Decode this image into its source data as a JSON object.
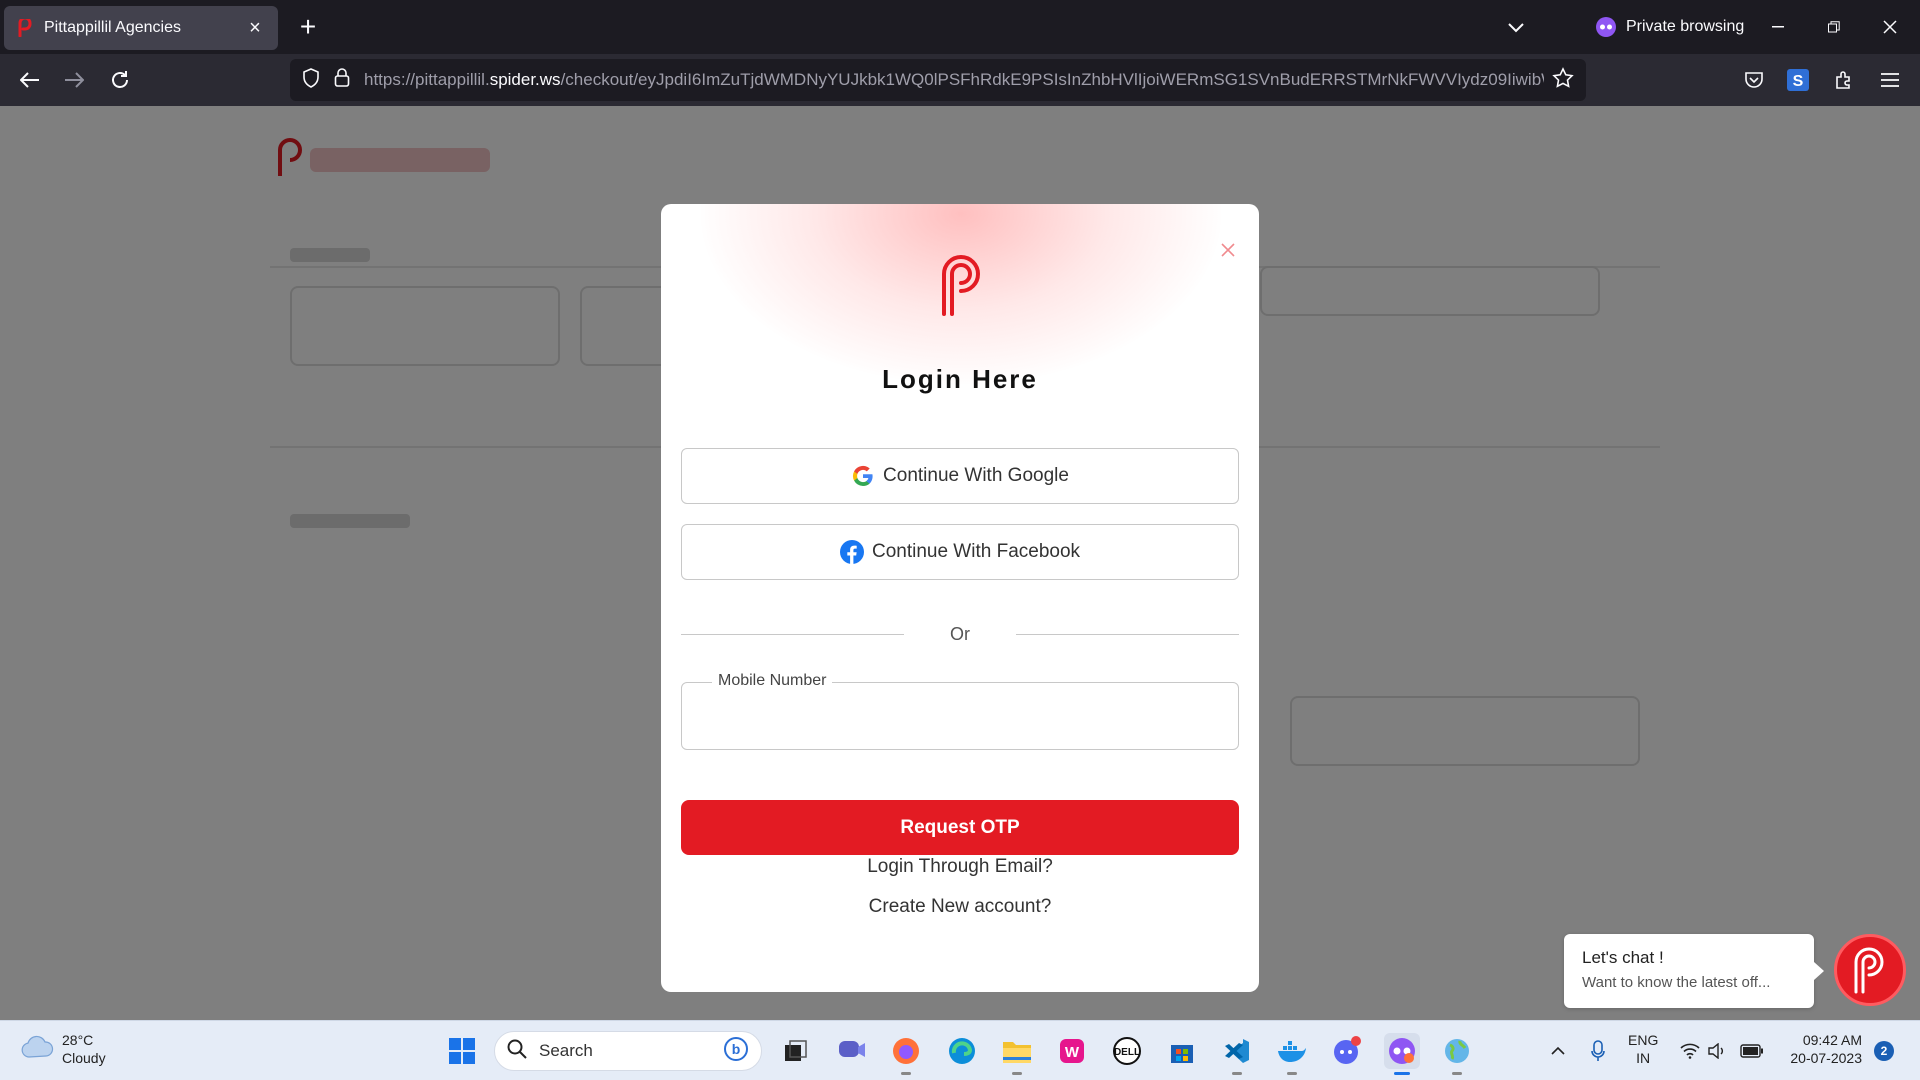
{
  "browser": {
    "tab": {
      "title": "Pittappillil Agencies"
    },
    "private_label": "Private browsing",
    "url": {
      "prefix": "https://pittappillil.",
      "host": "spider.ws",
      "path": "/checkout/eyJpdiI6ImZuTjdWMDNyYUJkbk1WQ0lPSFhRdkE9PSIsInZhbHVlIjoiWERmSG1SVnBudERRSTMrNkFWVVIydz09IiwibWF"
    }
  },
  "modal": {
    "title": "Login Here",
    "google_label": "Continue With Google",
    "facebook_label": "Continue With Facebook",
    "or_label": "Or",
    "mobile_label": "Mobile Number",
    "mobile_value": "",
    "otp_label": "Request OTP",
    "email_link": "Login Through Email?",
    "create_link": "Create New account?"
  },
  "chat": {
    "title": "Let's chat !",
    "subtitle": "Want to know the latest off..."
  },
  "taskbar": {
    "weather_temp": "28°C",
    "weather_cond": "Cloudy",
    "search_label": "Search",
    "lang_top": "ENG",
    "lang_bottom": "IN",
    "time": "09:42 AM",
    "date": "20-07-2023",
    "notification_count": "2"
  },
  "colors": {
    "brand_red": "#e31b23",
    "browser_dark": "#1c1b22",
    "private_purple": "#8f56f3"
  }
}
